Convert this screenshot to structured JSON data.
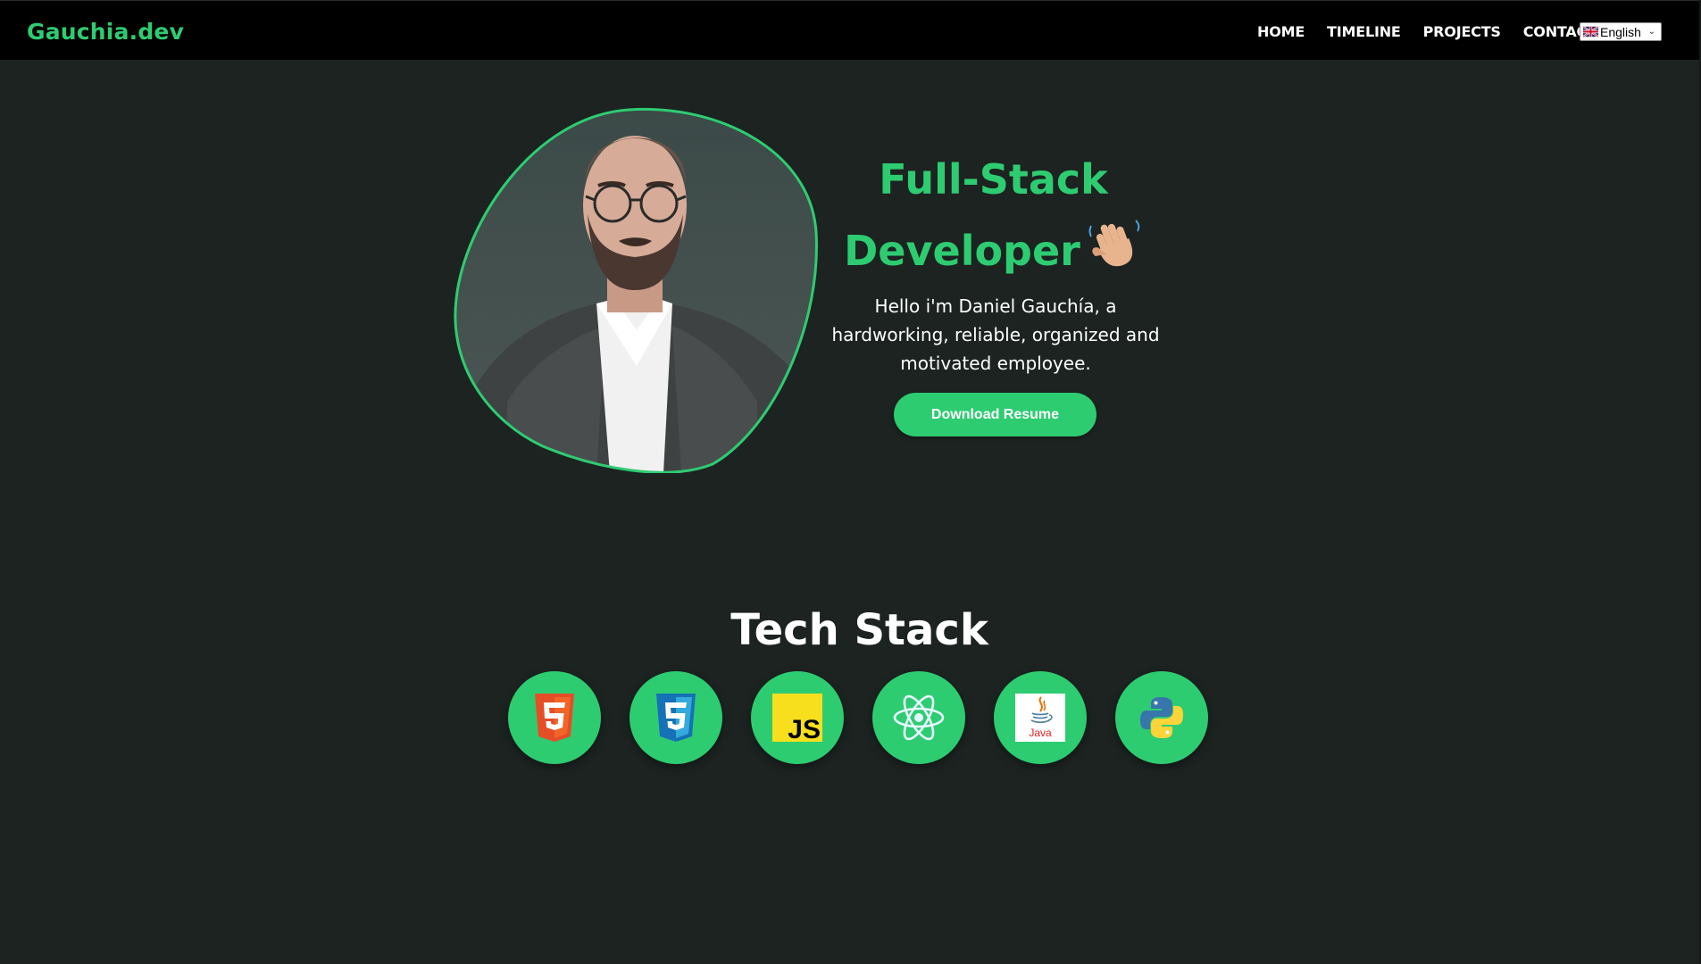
{
  "brand": "Gauchia.dev",
  "nav": {
    "items": [
      "HOME",
      "TIMELINE",
      "PROJECTS",
      "CONTACT"
    ],
    "language": {
      "selected": "English",
      "flag": "uk-flag-icon"
    }
  },
  "hero": {
    "title_line1": "Full-Stack",
    "title_line2": "Developer",
    "wave": "waving-hand-icon",
    "description": "Hello i'm Daniel Gauchía, a hardworking, reliable, organized and motivated employee.",
    "button": "Download Resume"
  },
  "tech_stack": {
    "title": "Tech Stack",
    "icons": [
      "html5-icon",
      "css3-icon",
      "javascript-icon",
      "react-icon",
      "java-icon",
      "python-icon"
    ]
  },
  "colors": {
    "accent": "#2ecc71",
    "background": "#1c2321",
    "navbar": "#000000"
  }
}
